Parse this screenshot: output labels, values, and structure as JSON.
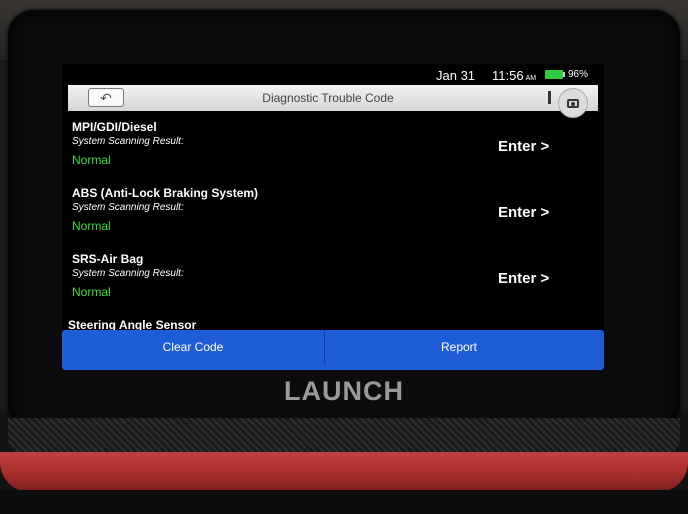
{
  "device": {
    "brand": "LAUNCH"
  },
  "status_bar": {
    "date": "Jan 31",
    "time": "11:56",
    "ampm": "AM",
    "battery": "96%",
    "battery_level": 0.96
  },
  "header": {
    "back_icon": "back-arrow-icon",
    "title": "Diagnostic Trouble Code",
    "camera_icon": "camera-icon"
  },
  "systems": [
    {
      "name": "MPI/GDI/Diesel",
      "scan_label": "System Scanning Result:",
      "status": "Normal",
      "action": "Enter >"
    },
    {
      "name": "ABS (Anti-Lock Braking System)",
      "scan_label": "System Scanning Result:",
      "status": "Normal",
      "action": "Enter >"
    },
    {
      "name": "SRS-Air Bag",
      "scan_label": "System Scanning Result:",
      "status": "Normal",
      "action": "Enter >"
    },
    {
      "name": "Steering Angle Sensor"
    }
  ],
  "actions": {
    "clear_code": "Clear Code",
    "report": "Report"
  },
  "colors": {
    "status_ok": "#3ddc3d",
    "action_bar": "#1f5cd8"
  }
}
